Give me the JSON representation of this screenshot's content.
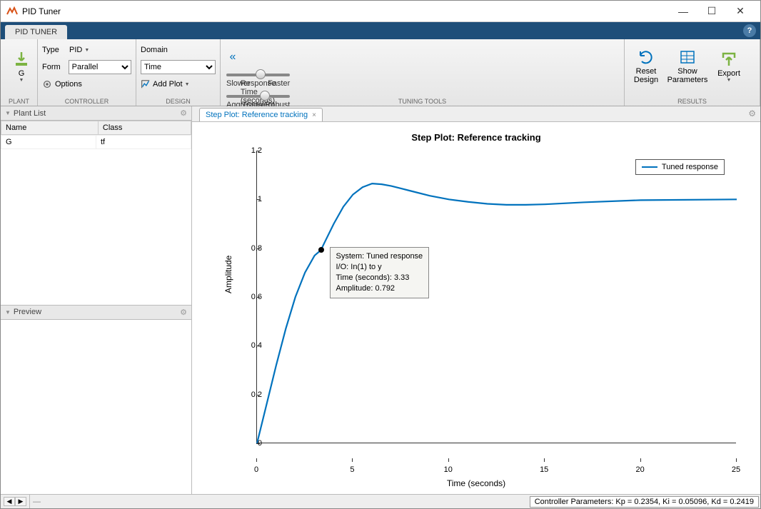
{
  "window": {
    "title": "PID Tuner"
  },
  "tabstrip": {
    "tab": "PID TUNER"
  },
  "toolstrip": {
    "plant": {
      "btn": "G",
      "label": "PLANT"
    },
    "controller": {
      "type_label": "Type",
      "type_value": "PID",
      "form_label": "Form",
      "form_value": "Parallel",
      "options": "Options",
      "label": "CONTROLLER"
    },
    "design": {
      "domain_label": "Domain",
      "domain_value": "Time",
      "add_plot": "Add Plot",
      "label": "DESIGN"
    },
    "tuning": {
      "label": "TUNING TOOLS",
      "rt_left": "Slower",
      "rt_center": "Response Time (seconds)",
      "rt_right": "Faster",
      "tb_left": "Aggressive",
      "tb_center": "Transient Behavior",
      "tb_right": "Robust",
      "rt_value": "4.590",
      "rt_pos": 54,
      "tb_value": "0.600",
      "tb_pos": 60
    },
    "results": {
      "reset": "Reset Design",
      "show": "Show Parameters",
      "export": "Export",
      "label": "RESULTS"
    }
  },
  "sidebar": {
    "plant_list": "Plant List",
    "preview": "Preview",
    "cols": {
      "name": "Name",
      "class": "Class"
    },
    "rows": [
      {
        "name": "G",
        "class": "tf"
      }
    ]
  },
  "plot_tab": {
    "label": "Step Plot: Reference tracking"
  },
  "chart_data": {
    "type": "line",
    "title": "Step Plot: Reference tracking",
    "xlabel": "Time (seconds)",
    "ylabel": "Amplitude",
    "xlim": [
      0,
      25
    ],
    "ylim": [
      0,
      1.2
    ],
    "xticks": [
      0,
      5,
      10,
      15,
      20,
      25
    ],
    "yticks": [
      0,
      0.2,
      0.4,
      0.6,
      0.8,
      1,
      1.2
    ],
    "series": [
      {
        "name": "Tuned response",
        "x": [
          0,
          0.5,
          1,
          1.5,
          2,
          2.5,
          3,
          3.33,
          3.5,
          4,
          4.5,
          5,
          5.5,
          6,
          6.5,
          7,
          7.5,
          8,
          9,
          10,
          11,
          12,
          13,
          14,
          15,
          17,
          20,
          25
        ],
        "y": [
          0,
          0.16,
          0.32,
          0.47,
          0.6,
          0.7,
          0.77,
          0.792,
          0.82,
          0.9,
          0.97,
          1.02,
          1.05,
          1.065,
          1.062,
          1.055,
          1.045,
          1.035,
          1.015,
          1.0,
          0.99,
          0.982,
          0.978,
          0.978,
          0.98,
          0.988,
          0.997,
          1.0
        ]
      }
    ],
    "legend": "Tuned response",
    "datatip": {
      "l1": "System: Tuned response",
      "l2": "I/O: In(1) to y",
      "l3": "Time (seconds): 3.33",
      "l4": "Amplitude: 0.792",
      "x": 3.33,
      "y": 0.792
    }
  },
  "status": {
    "params": "Controller Parameters: Kp = 0.2354, Ki = 0.05096, Kd = 0.2419"
  }
}
